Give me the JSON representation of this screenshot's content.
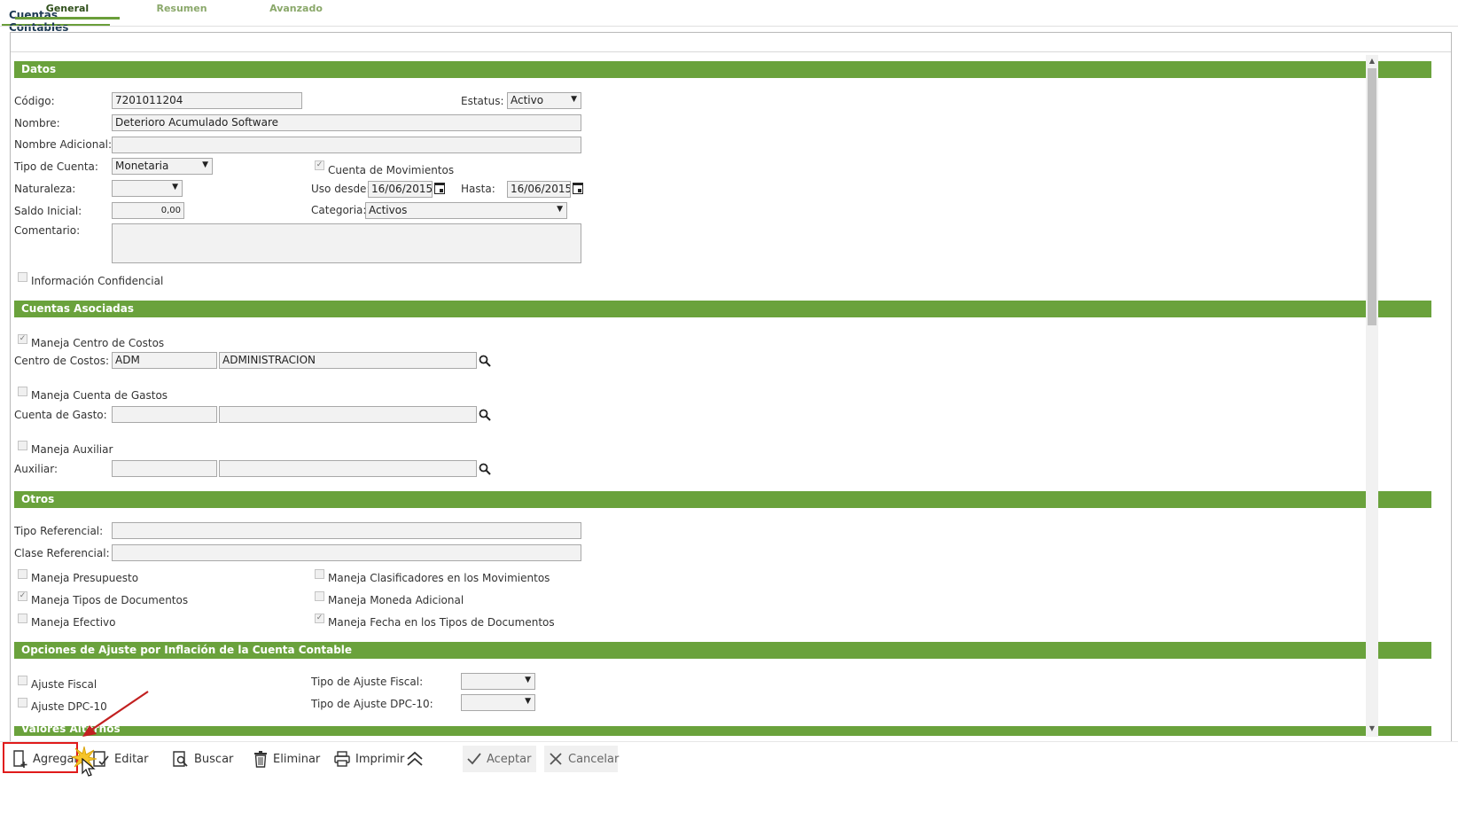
{
  "window_tab": "Cuentas Contables",
  "subtabs": [
    "General",
    "Resumen",
    "Avanzado"
  ],
  "sections": {
    "datos": "Datos",
    "cuentas_asociadas": "Cuentas Asociadas",
    "otros": "Otros",
    "ajuste": "Opciones de Ajuste por Inflación de la Cuenta Contable",
    "valores": "Valores Alternos"
  },
  "datos": {
    "codigo_label": "Código:",
    "codigo_value": "7201011204",
    "estatus_label": "Estatus:",
    "estatus_value": "Activo",
    "nombre_label": "Nombre:",
    "nombre_value": "Deterioro Acumulado Software",
    "nombre_adicional_label": "Nombre Adicional:",
    "nombre_adicional_value": "",
    "tipo_cuenta_label": "Tipo de Cuenta:",
    "tipo_cuenta_value": "Monetaria",
    "cuenta_movimientos_label": "Cuenta de Movimientos",
    "naturaleza_label": "Naturaleza:",
    "naturaleza_value": "",
    "uso_desde_label": "Uso desde:",
    "uso_desde_value": "16/06/2015",
    "hasta_label": "Hasta:",
    "hasta_value": "16/06/2015",
    "saldo_inicial_label": "Saldo Inicial:",
    "saldo_inicial_value": "0,00",
    "categoria_label": "Categoria:",
    "categoria_value": "Activos",
    "comentario_label": "Comentario:",
    "comentario_value": "",
    "info_confidencial_label": "Información Confidencial"
  },
  "asociadas": {
    "maneja_centro_label": "Maneja Centro de Costos",
    "centro_label": "Centro de Costos:",
    "centro_code": "ADM",
    "centro_name": "ADMINISTRACION",
    "maneja_gastos_label": "Maneja Cuenta de Gastos",
    "gasto_label": "Cuenta de Gasto:",
    "gasto_code": "",
    "gasto_name": "",
    "maneja_auxiliar_label": "Maneja Auxiliar",
    "auxiliar_label": "Auxiliar:",
    "auxiliar_code": "",
    "auxiliar_name": ""
  },
  "otros": {
    "tipo_ref_label": "Tipo Referencial:",
    "tipo_ref_value": "",
    "clase_ref_label": "Clase Referencial:",
    "clase_ref_value": "",
    "presupuesto_label": "Maneja Presupuesto",
    "clasificadores_label": "Maneja Clasificadores en los Movimientos",
    "tipos_docs_label": "Maneja Tipos de Documentos",
    "moneda_label": "Maneja Moneda Adicional",
    "efectivo_label": "Maneja Efectivo",
    "fecha_docs_label": "Maneja Fecha en los Tipos de Documentos"
  },
  "ajuste": {
    "fiscal_label": "Ajuste Fiscal",
    "dpc_label": "Ajuste DPC-10",
    "tipo_fiscal_label": "Tipo de Ajuste Fiscal:",
    "tipo_fiscal_value": "",
    "tipo_dpc_label": "Tipo de Ajuste DPC-10:",
    "tipo_dpc_value": ""
  },
  "toolbar": {
    "agregar": "Agregar",
    "editar": "Editar",
    "buscar": "Buscar",
    "eliminar": "Eliminar",
    "imprimir": "Imprimir",
    "aceptar": "Aceptar",
    "cancelar": "Cancelar"
  },
  "colors": {
    "section_bg": "#6aa23c",
    "highlight": "#e01b1b"
  }
}
